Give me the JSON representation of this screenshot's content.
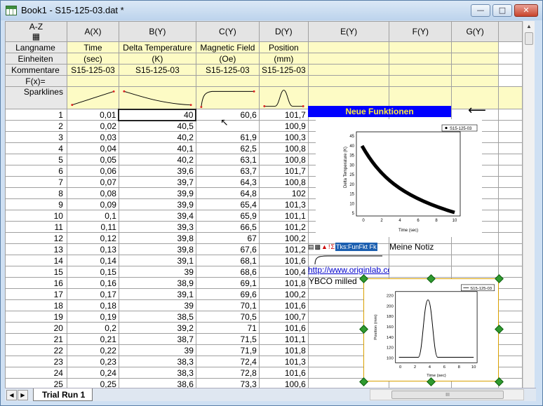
{
  "window": {
    "title": "Book1 - S15-125-03.dat *"
  },
  "columns": [
    "A(X)",
    "B(Y)",
    "C(Y)",
    "D(Y)",
    "E(Y)",
    "F(Y)",
    "G(Y)"
  ],
  "meta_rows": [
    {
      "label": "Langname",
      "cells": [
        "Time",
        "Delta Temperature",
        "Magnetic Field",
        "Position",
        "",
        "",
        ""
      ]
    },
    {
      "label": "Einheiten",
      "cells": [
        "(sec)",
        "(K)",
        "(Oe)",
        "(mm)",
        "",
        "",
        ""
      ]
    },
    {
      "label": "Kommentare",
      "cells": [
        "S15-125-03",
        "S15-125-03",
        "S15-125-03",
        "S15-125-03",
        "",
        "",
        ""
      ]
    },
    {
      "label": "F(x)=",
      "cells": [
        "",
        "",
        "",
        "",
        "",
        "",
        ""
      ]
    }
  ],
  "sparklines_label": "Sparklines",
  "sparkline_shapes": [
    "line-rising",
    "decay",
    "saturating-rise",
    "gaussian-peak"
  ],
  "rows": [
    [
      "1",
      "0,01",
      "40",
      "60,6",
      "101,7"
    ],
    [
      "2",
      "0,02",
      "40,5",
      "",
      "100,9"
    ],
    [
      "3",
      "0,03",
      "40,2",
      "61,9",
      "100,3"
    ],
    [
      "4",
      "0,04",
      "40,1",
      "62,5",
      "100,8"
    ],
    [
      "5",
      "0,05",
      "40,2",
      "63,1",
      "100,8"
    ],
    [
      "6",
      "0,06",
      "39,6",
      "63,7",
      "101,7"
    ],
    [
      "7",
      "0,07",
      "39,7",
      "64,3",
      "100,8"
    ],
    [
      "8",
      "0,08",
      "39,9",
      "64,8",
      "102"
    ],
    [
      "9",
      "0,09",
      "39,9",
      "65,4",
      "101,3"
    ],
    [
      "10",
      "0,1",
      "39,4",
      "65,9",
      "101,1"
    ],
    [
      "11",
      "0,11",
      "39,3",
      "66,5",
      "101,2"
    ],
    [
      "12",
      "0,12",
      "39,8",
      "67",
      "100,2"
    ],
    [
      "13",
      "0,13",
      "39,8",
      "67,6",
      "101,2"
    ],
    [
      "14",
      "0,14",
      "39,1",
      "68,1",
      "101,6"
    ],
    [
      "15",
      "0,15",
      "39",
      "68,6",
      "100,4"
    ],
    [
      "16",
      "0,16",
      "38,9",
      "69,1",
      "101,8"
    ],
    [
      "17",
      "0,17",
      "39,1",
      "69,6",
      "100,2"
    ],
    [
      "18",
      "0,18",
      "39",
      "70,1",
      "101,6"
    ],
    [
      "19",
      "0,19",
      "38,5",
      "70,5",
      "100,7"
    ],
    [
      "20",
      "0,2",
      "39,2",
      "71",
      "101,6"
    ],
    [
      "21",
      "0,21",
      "38,7",
      "71,5",
      "101,1"
    ],
    [
      "22",
      "0,22",
      "39",
      "71,9",
      "101,8"
    ],
    [
      "23",
      "0,23",
      "38,3",
      "72,4",
      "101,3"
    ],
    [
      "24",
      "0,24",
      "38,3",
      "72,8",
      "101,6"
    ],
    [
      "25",
      "0,25",
      "38,6",
      "73,3",
      "100,6"
    ]
  ],
  "overlays": {
    "neue_funktionen": "Neue Funktionen",
    "note": "Meine Notiz",
    "link": "http://www.originlab.com",
    "ybco": "YBCO milled",
    "toolbar_text": "Tks:FunFkt Fk"
  },
  "graph1": {
    "legend": "S15-125-03",
    "ylabel": "Delta Temperature (K)",
    "xlabel": "Time (sec)",
    "yticks": [
      "5",
      "10",
      "15",
      "20",
      "25",
      "30",
      "35",
      "40",
      "45"
    ],
    "xticks": [
      "0",
      "2",
      "4",
      "6",
      "8",
      "10"
    ]
  },
  "graph2": {
    "legend": "S15-125-03",
    "ylabel": "Position (mm)",
    "xlabel": "Time (sec)",
    "yticks": [
      "100",
      "120",
      "140",
      "160",
      "180",
      "200",
      "220"
    ],
    "xticks": [
      "0",
      "2",
      "4",
      "6",
      "8",
      "10"
    ]
  },
  "tabs": {
    "active": "Trial Run 1"
  },
  "scroll": {
    "thumb_text": "III"
  },
  "icons": {
    "arrow": "black-left-arrow-icon",
    "cursor": "resize-cursor-icon"
  },
  "colors": {
    "meta_bg": "#fdfbc5",
    "banner_bg": "#0000ff",
    "banner_text": "#ffeb3b",
    "handle": "#2f9a2f"
  }
}
